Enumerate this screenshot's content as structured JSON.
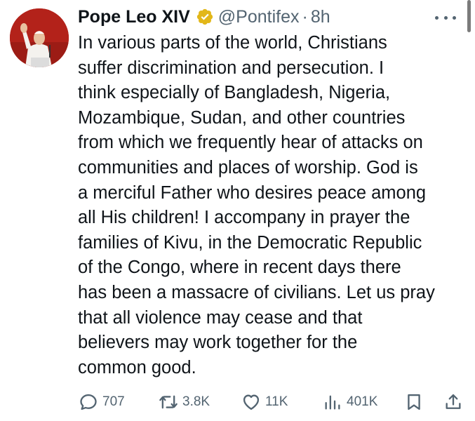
{
  "author": {
    "display_name": "Pope Leo XIV",
    "handle": "@Pontifex",
    "separator": "·",
    "time": "8h",
    "verified_icon": "gold-verified-badge-icon",
    "avatar": "pope-waving-avatar"
  },
  "tweet": {
    "lines": [
      "In various parts of the world, Christians",
      "suffer discrimination and persecution. I",
      "think especially of Bangladesh, Nigeria,",
      "Mozambique, Sudan, and other countries",
      "from which we frequently hear of attacks on",
      "communities and places of worship. God is",
      "a merciful Father who desires peace among",
      "all His children! I accompany in prayer the",
      "families of Kivu, in the Democratic Republic",
      "of the Congo, where in recent days there",
      "has been a massacre of civilians. Let us pray",
      "that all violence may cease and that",
      "believers may work together for the",
      "common good."
    ]
  },
  "actions": {
    "replies": "707",
    "reposts": "3.8K",
    "likes": "11K",
    "views": "401K"
  },
  "colors": {
    "text": "#0f1419",
    "secondary": "#536471",
    "verified_gold": "#e2b719"
  }
}
